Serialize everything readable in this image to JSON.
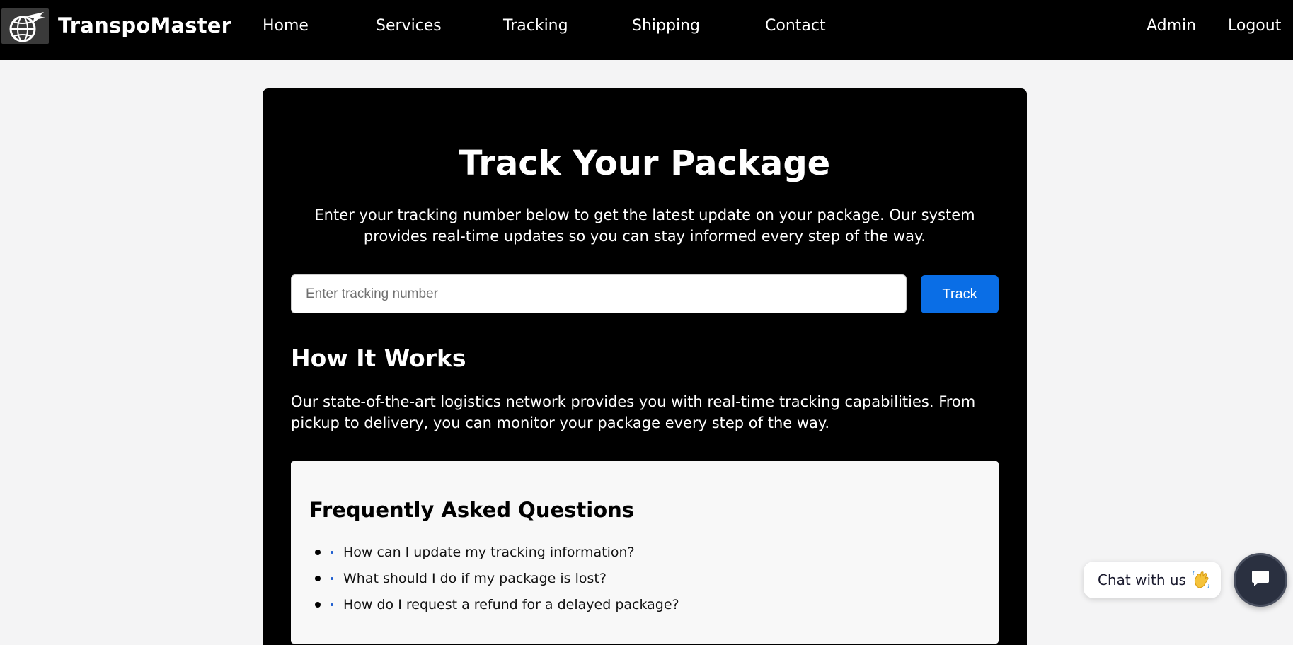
{
  "brand": {
    "name": "TranspoMaster",
    "logo_icon": "globe-plane-icon"
  },
  "nav": {
    "links": [
      "Home",
      "Services",
      "Tracking",
      "Shipping",
      "Contact"
    ],
    "right": [
      "Admin",
      "Logout"
    ]
  },
  "hero": {
    "title": "Track Your Package",
    "lead": "Enter your tracking number below to get the latest update on your package. Our system provides real-time updates so you can stay informed every step of the way."
  },
  "tracking": {
    "placeholder": "Enter tracking number",
    "value": "",
    "button_label": "Track"
  },
  "how": {
    "title": "How It Works",
    "text": "Our state-of-the-art logistics network provides you with real-time tracking capabilities. From pickup to delivery, you can monitor your package every step of the way."
  },
  "faq": {
    "title": "Frequently Asked Questions",
    "items": [
      "How can I update my tracking information?",
      "What should I do if my package is lost?",
      "How do I request a refund for a delayed package?"
    ]
  },
  "chat": {
    "label": "Chat with us",
    "emoji_icon": "waving-hand-icon",
    "button_icon": "chat-bubble-icon"
  },
  "colors": {
    "accent": "#0a6ee6",
    "navbar": "#000000",
    "card": "#000000",
    "background": "#f4f4f5"
  }
}
